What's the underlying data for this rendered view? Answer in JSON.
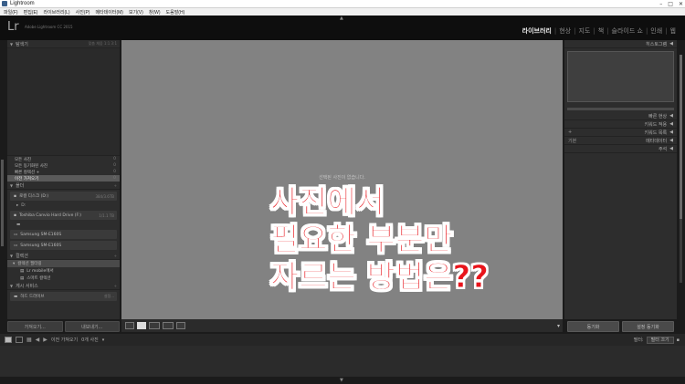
{
  "window": {
    "title": "Lightroom",
    "controls": [
      "–",
      "□",
      "✕"
    ]
  },
  "menu": [
    "파일(F)",
    "편집(E)",
    "라이브러리(L)",
    "사진(P)",
    "메타데이터(M)",
    "보기(V)",
    "창(W)",
    "도움말(H)"
  ],
  "identity": {
    "logo": "Lr",
    "product": "Adobe Lightroom CC 2015"
  },
  "modules": {
    "items": [
      "라이브러리",
      "현상",
      "지도",
      "책",
      "슬라이드 쇼",
      "인쇄",
      "웹"
    ],
    "active_index": 0
  },
  "left_panel": {
    "navigator": {
      "title": "탐색기",
      "options": "맞춤  채움  1:1  3:1"
    },
    "catalog": {
      "rows": [
        {
          "label": "모든 사진",
          "count": "0"
        },
        {
          "label": "모든 동기화된 사진",
          "count": "0"
        },
        {
          "label": "빠른 컬렉션 +",
          "count": "0"
        },
        {
          "label": "이전 가져오기",
          "count": "0"
        }
      ]
    },
    "folders": {
      "title": "폴더",
      "volumes": [
        {
          "name": "로컬 디스크 (D:)",
          "space": "384/3.6TB"
        },
        {
          "name": "Toshiba Canvio Hard Drive (F:)",
          "space": "1/1.1 TB"
        },
        {
          "name": "Samsung SM-E160S",
          "space": ""
        },
        {
          "name": "Samsung SM-E160S",
          "space": ""
        }
      ],
      "sub_items": [
        "D:",
        ""
      ]
    },
    "collections": {
      "title": "컬렉션",
      "filter_label": "컬렉션 필터링",
      "items": [
        "Lr mobile에서",
        "스마트 컬렉션"
      ]
    },
    "publish": {
      "title": "게시 서비스",
      "item": "하드 드라이브",
      "setting": "설정..."
    },
    "buttons": {
      "import": "가져오기...",
      "export": "내보내기..."
    }
  },
  "center": {
    "empty_message": "선택된 사진이 없습니다.",
    "overlay_lines": [
      "사진에서",
      "필요한 부분만",
      "자르는 방법은??"
    ]
  },
  "toolbar": {
    "views": [
      "grid-view-icon",
      "loupe-view-icon",
      "compare-view-icon",
      "survey-view-icon",
      "people-view-icon"
    ],
    "dropdown": "▾"
  },
  "right_panel": {
    "histogram_title": "히스토그램",
    "sections": [
      "빠른 현상",
      "키워드 적용",
      "키워드 목록",
      "메타데이터",
      "주석"
    ],
    "quick_dev_value": "기본",
    "metadata_preset": "기본",
    "buttons": {
      "sync": "동기화",
      "sync_settings": "설정 동기화"
    }
  },
  "filmstrip": {
    "screen_nums": [
      "1",
      "2"
    ],
    "source": "이전 가져오기",
    "count": "0개 사진",
    "filter_label": "필터:",
    "filter_value": "필터 끄기"
  }
}
